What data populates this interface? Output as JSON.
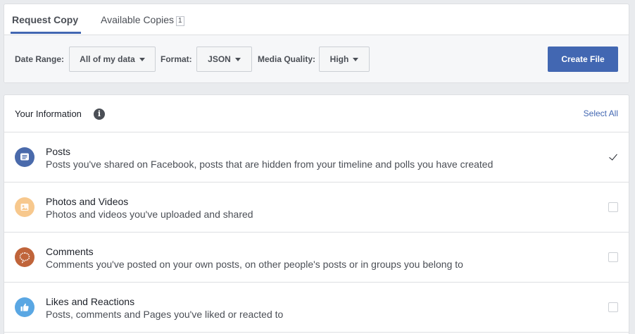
{
  "tabs": [
    {
      "label": "Request Copy"
    },
    {
      "label": "Available Copies",
      "count": "1"
    }
  ],
  "toolbar": {
    "date_range_label": "Date Range:",
    "date_range_value": "All of my data",
    "format_label": "Format:",
    "format_value": "JSON",
    "media_quality_label": "Media Quality:",
    "media_quality_value": "High",
    "create_button": "Create File"
  },
  "info": {
    "title": "Your Information",
    "info_icon_glyph": "i",
    "select_all": "Select All",
    "items": [
      {
        "title": "Posts",
        "description": "Posts you've shared on Facebook, posts that are hidden from your timeline and polls you have created",
        "icon": "posts-icon",
        "color": "#4a6aab",
        "checked": true
      },
      {
        "title": "Photos and Videos",
        "description": "Photos and videos you've uploaded and shared",
        "icon": "photos-icon",
        "color": "#f7c88d",
        "checked": false
      },
      {
        "title": "Comments",
        "description": "Comments you've posted on your own posts, on other people's posts or in groups you belong to",
        "icon": "comments-icon",
        "color": "#c0643a",
        "checked": false
      },
      {
        "title": "Likes and Reactions",
        "description": "Posts, comments and Pages you've liked or reacted to",
        "icon": "likes-icon",
        "color": "#5aa7e3",
        "checked": false
      }
    ]
  },
  "colors": {
    "accent": "#4267b2",
    "background": "#e9ebee"
  }
}
